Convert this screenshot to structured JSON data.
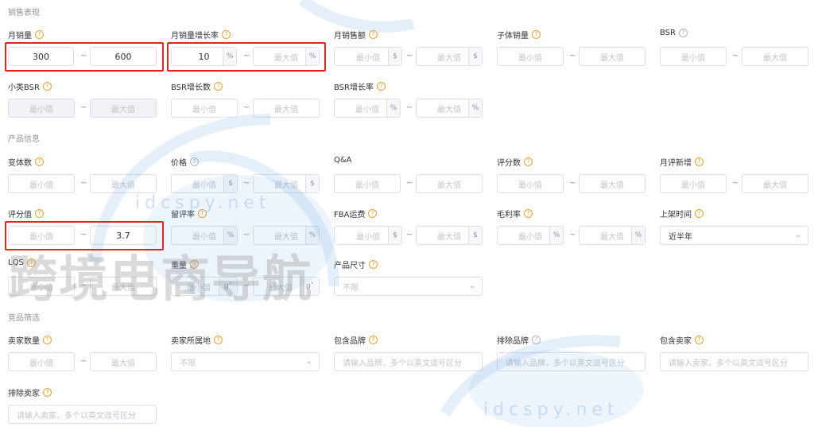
{
  "ui": {
    "tilde": "~",
    "placeholder_min": "最小值",
    "placeholder_max": "最大值"
  },
  "sections": {
    "sales": "销售表现",
    "product": "产品信息",
    "competitor": "竞品筛选"
  },
  "fields": {
    "monthly_sales": {
      "label": "月销量",
      "min": "300",
      "max": "600"
    },
    "monthly_sales_growth": {
      "label": "月销量增长率",
      "min": "10",
      "unit": "%"
    },
    "monthly_revenue": {
      "label": "月销售额",
      "unit": "$"
    },
    "child_sales": {
      "label": "子体销量"
    },
    "bsr": {
      "label": "BSR"
    },
    "sub_bsr": {
      "label": "小类BSR"
    },
    "bsr_growth_count": {
      "label": "BSR增长数"
    },
    "bsr_growth_rate": {
      "label": "BSR增长率",
      "unit": "%"
    },
    "variant_count": {
      "label": "变体数"
    },
    "price": {
      "label": "价格",
      "unit": "$"
    },
    "qa": {
      "label": "Q&A"
    },
    "review_count": {
      "label": "评分数"
    },
    "monthly_new_reviews": {
      "label": "月评新增"
    },
    "rating": {
      "label": "评分值",
      "max": "3.7"
    },
    "review_rate": {
      "label": "留评率",
      "unit": "%"
    },
    "fba_fee": {
      "label": "FBA运费",
      "unit": "$"
    },
    "gross_margin": {
      "label": "毛利率",
      "unit": "%"
    },
    "launch_time": {
      "label": "上架时间",
      "value": "近半年"
    },
    "lqs": {
      "label": "LQS"
    },
    "weight": {
      "label": "重量",
      "unit": "g"
    },
    "product_size": {
      "label": "产品尺寸",
      "value": "不限"
    },
    "seller_count": {
      "label": "卖家数量"
    },
    "seller_location": {
      "label": "卖家所属地",
      "value": "不限"
    },
    "include_brand": {
      "label": "包含品牌",
      "placeholder": "请输入品牌，多个以英文逗号区分"
    },
    "exclude_brand": {
      "label": "排除品牌",
      "placeholder": "请输入品牌，多个以英文逗号区分"
    },
    "include_seller": {
      "label": "包含卖家",
      "placeholder": "请输入卖家，多个以英文逗号区分"
    },
    "exclude_seller": {
      "label": "排除卖家",
      "placeholder": "请输入卖家，多个以英文逗号区分"
    }
  },
  "watermark": {
    "brand": "跨境电商导航",
    "url": "idcspy.net"
  },
  "colors": {
    "highlight": "#e0241f",
    "help_icon": "#e6a23c",
    "border": "#dcdfe6"
  }
}
